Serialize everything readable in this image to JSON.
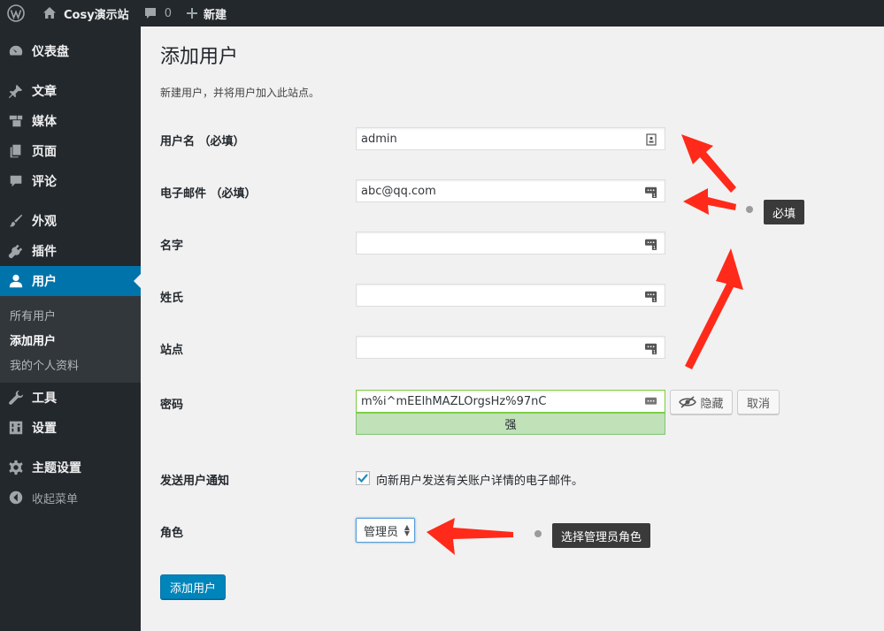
{
  "adminbar": {
    "site_name": "Cosy演示站",
    "comments_count": "0",
    "new_label": "新建"
  },
  "sidebar": {
    "items": [
      {
        "label": "仪表盘",
        "icon": "dashboard-icon"
      },
      {
        "label": "文章",
        "icon": "pin-icon"
      },
      {
        "label": "媒体",
        "icon": "media-icon"
      },
      {
        "label": "页面",
        "icon": "page-icon"
      },
      {
        "label": "评论",
        "icon": "comment-icon"
      },
      {
        "label": "外观",
        "icon": "brush-icon"
      },
      {
        "label": "插件",
        "icon": "plugin-icon"
      },
      {
        "label": "用户",
        "icon": "user-icon"
      },
      {
        "label": "工具",
        "icon": "wrench-icon"
      },
      {
        "label": "设置",
        "icon": "settings-icon"
      },
      {
        "label": "主题设置",
        "icon": "gear-icon"
      },
      {
        "label": "收起菜单",
        "icon": "collapse-icon"
      }
    ],
    "users_submenu": [
      "所有用户",
      "添加用户",
      "我的个人资料"
    ]
  },
  "page": {
    "title": "添加用户",
    "description": "新建用户，并将用户加入此站点。"
  },
  "form": {
    "username_label": "用户名 （必填）",
    "username_value": "admin",
    "email_label": "电子邮件 （必填）",
    "email_value": "abc@qq.com",
    "firstname_label": "名字",
    "lastname_label": "姓氏",
    "website_label": "站点",
    "password_label": "密码",
    "password_value": "m%i^mEElhMAZLOrgsHz%97nC",
    "hide_label": "隐藏",
    "cancel_label": "取消",
    "strength_label": "强",
    "notify_label": "发送用户通知",
    "notify_text": "向新用户发送有关账户详情的电子邮件。",
    "role_label": "角色",
    "role_value": "管理员",
    "submit_label": "添加用户"
  },
  "annotations": {
    "required_tip": "必填",
    "role_tip": "选择管理员角色",
    "arrow_color": "#ff2a1a"
  }
}
